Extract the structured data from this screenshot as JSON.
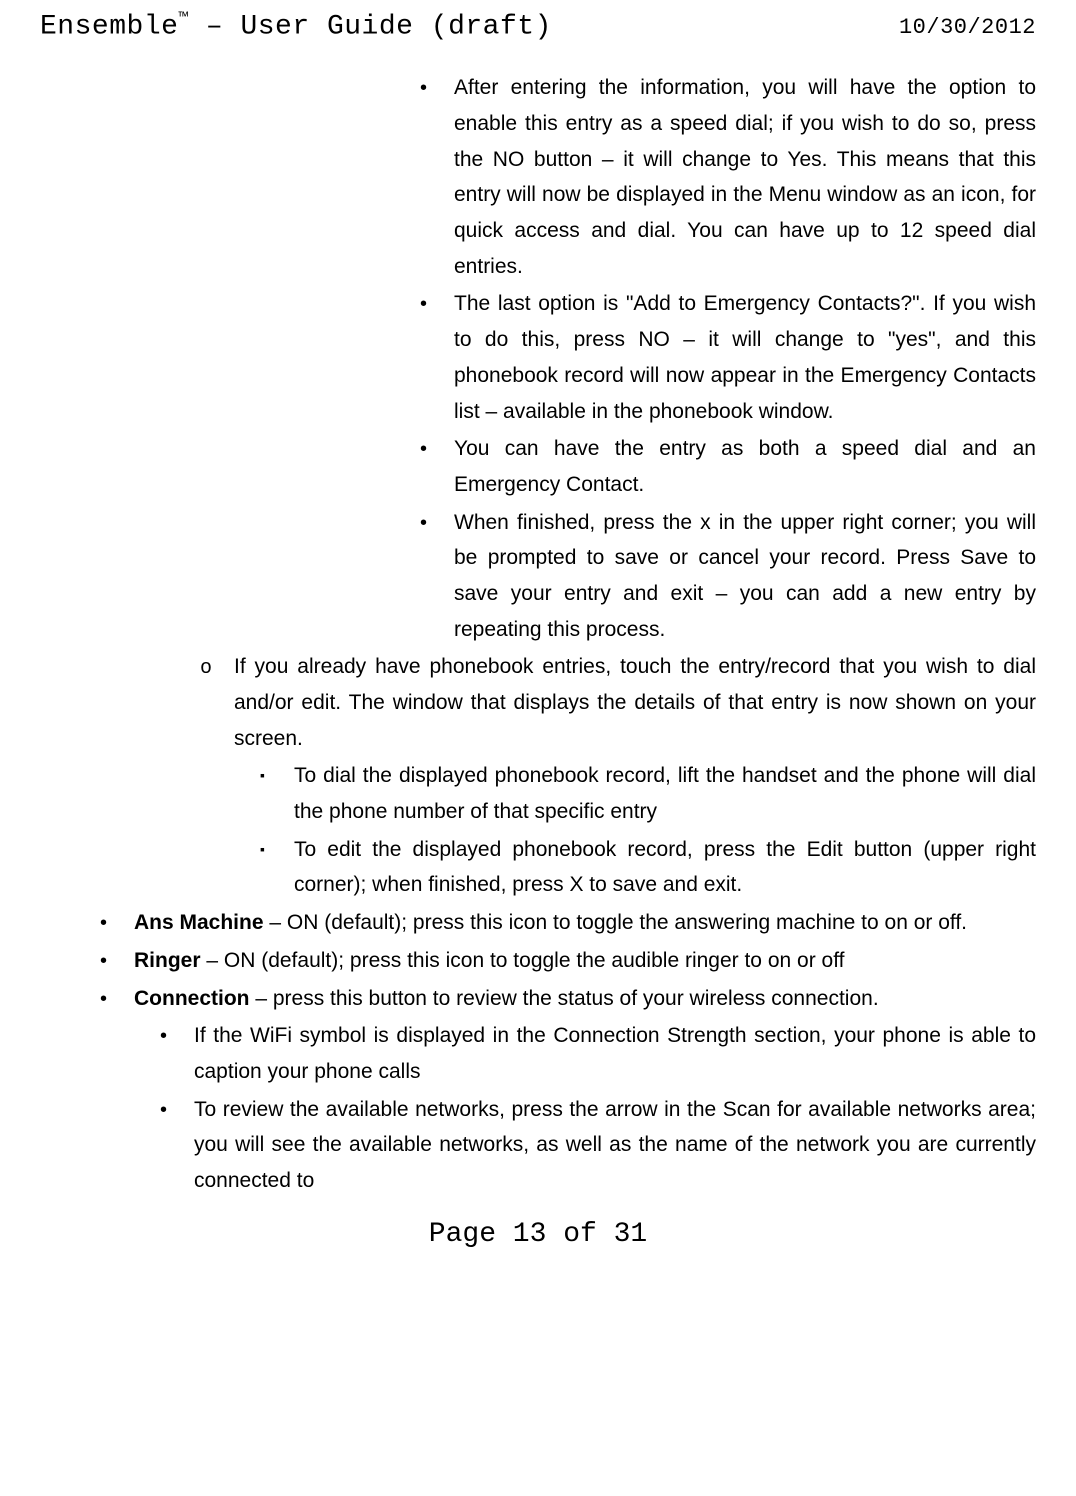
{
  "header": {
    "title_prefix": "Ensemble",
    "tm": "™",
    "title_suffix": " – User Guide (draft)",
    "date": "10/30/2012"
  },
  "content": {
    "lvl4_bullets": [
      "After entering the information, you will have the option to enable this entry as a speed dial; if you wish to do so, press the NO button – it will change to Yes. This means that this entry will now be displayed in the Menu window as an icon, for quick access and dial. You can have up to 12 speed dial entries.",
      "The last option is \"Add to Emergency Contacts?\". If you wish to do this, press NO – it will change to \"yes\", and this phonebook record will now appear in the Emergency Contacts list – available in the phonebook window.",
      "You can have the entry as both a speed dial and an Emergency Contact.",
      "When finished, press the x in the upper right corner; you will be prompted to save or cancel your record. Press Save to save your entry and exit – you can add a new entry by repeating this process."
    ],
    "lvl3_circle": "If you already have phonebook entries, touch the entry/record that you wish to dial and/or edit. The window that displays the details of that entry is now shown on your screen.",
    "lvl4_squares": [
      "To dial the displayed phonebook record, lift the handset and the phone will dial the phone number of that specific entry",
      "To edit the displayed phonebook record, press the Edit button (upper right corner); when finished, press X to save and exit."
    ],
    "ans_label": "Ans Machine",
    "ans_text": " – ON (default); press this icon to toggle the answering machine to on or off.",
    "ringer_label": "Ringer",
    "ringer_text": " – ON (default); press this icon to toggle the audible ringer to on or off",
    "conn_label": "Connection",
    "conn_text": " – press this button to review the status of your wireless connection.",
    "conn_sub": [
      "If the WiFi symbol is displayed in the Connection Strength section, your phone is able to caption your phone calls",
      "To review the available networks, press the arrow in the Scan for available networks area; you will see the available networks, as well as the name of the network you are currently connected to"
    ]
  },
  "footer": "Page 13 of 31"
}
